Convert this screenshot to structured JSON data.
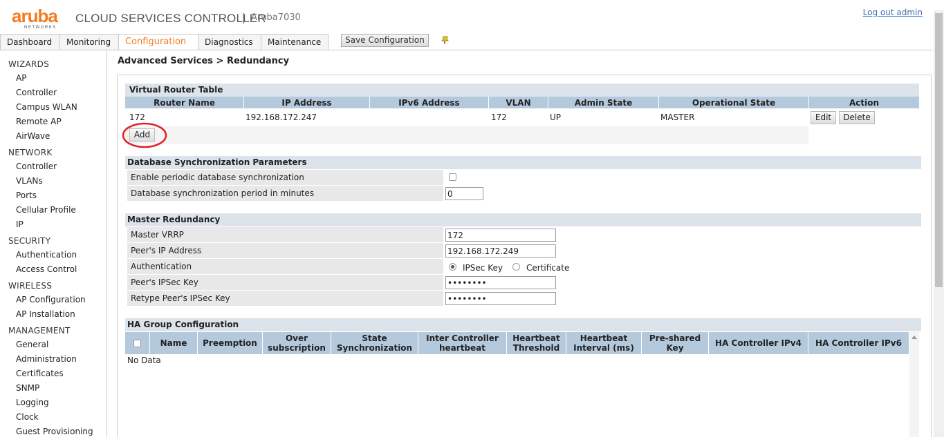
{
  "header": {
    "logo_word": "aruba",
    "logo_sub": "NETWORKS",
    "app_title": "CLOUD SERVICES CONTROLLER",
    "separator": "|",
    "hostname": "Aruba7030",
    "logout": "Log out admin"
  },
  "tabs": [
    "Dashboard",
    "Monitoring",
    "Configuration",
    "Diagnostics",
    "Maintenance"
  ],
  "active_tab": "Configuration",
  "save_button": "Save Configuration",
  "sidebar": {
    "sections": [
      {
        "title": "WIZARDS",
        "items": [
          "AP",
          "Controller",
          "Campus WLAN",
          "Remote AP",
          "AirWave"
        ]
      },
      {
        "title": "NETWORK",
        "items": [
          "Controller",
          "VLANs",
          "Ports",
          "Cellular Profile",
          "IP"
        ]
      },
      {
        "title": "SECURITY",
        "items": [
          "Authentication",
          "Access Control"
        ]
      },
      {
        "title": "WIRELESS",
        "items": [
          "AP Configuration",
          "AP Installation"
        ]
      },
      {
        "title": "MANAGEMENT",
        "items": [
          "General",
          "Administration",
          "Certificates",
          "SNMP",
          "Logging",
          "Clock",
          "Guest Provisioning"
        ]
      }
    ]
  },
  "breadcrumb": "Advanced Services > Redundancy",
  "vrt": {
    "title": "Virtual Router Table",
    "headers": [
      "Router Name",
      "IP Address",
      "IPv6 Address",
      "VLAN",
      "Admin State",
      "Operational State",
      "Action"
    ],
    "row": {
      "router_name": "172",
      "ip": "192.168.172.247",
      "ipv6": "",
      "vlan": "172",
      "admin": "UP",
      "oper": "MASTER"
    },
    "edit": "Edit",
    "delete": "Delete",
    "add": "Add"
  },
  "dbsync": {
    "title": "Database Synchronization Parameters",
    "enable_label": "Enable periodic database synchronization",
    "enable_checked": false,
    "period_label": "Database synchronization period in minutes",
    "period_value": "0"
  },
  "master": {
    "title": "Master Redundancy",
    "vrrp_label": "Master VRRP",
    "vrrp_value": "172",
    "peer_ip_label": "Peer's IP Address",
    "peer_ip_value": "192.168.172.249",
    "auth_label": "Authentication",
    "auth_opt1": "IPSec Key",
    "auth_opt2": "Certificate",
    "auth_selected": "IPSec Key",
    "key_label": "Peer's IPSec Key",
    "key_value": "12345678",
    "retype_label": "Retype Peer's IPSec Key",
    "retype_value": "12345678"
  },
  "ha": {
    "title": "HA Group Configuration",
    "headers": [
      {
        "l1": "Name",
        "l2": ""
      },
      {
        "l1": "Preemption",
        "l2": ""
      },
      {
        "l1": "Over",
        "l2": "subscription"
      },
      {
        "l1": "State",
        "l2": "Synchronization"
      },
      {
        "l1": "Inter Controller",
        "l2": "heartbeat"
      },
      {
        "l1": "Heartbeat",
        "l2": "Threshold"
      },
      {
        "l1": "Heartbeat",
        "l2": "Interval (ms)"
      },
      {
        "l1": "Pre-shared",
        "l2": "Key"
      },
      {
        "l1": "HA Controller IPv4",
        "l2": ""
      },
      {
        "l1": "HA Controller IPv6",
        "l2": ""
      }
    ],
    "empty": "No Data"
  },
  "colors": {
    "accent": "#f47b20",
    "table_header": "#b5c9dd",
    "section_header": "#dce3ea",
    "annotation": "#e02020"
  }
}
